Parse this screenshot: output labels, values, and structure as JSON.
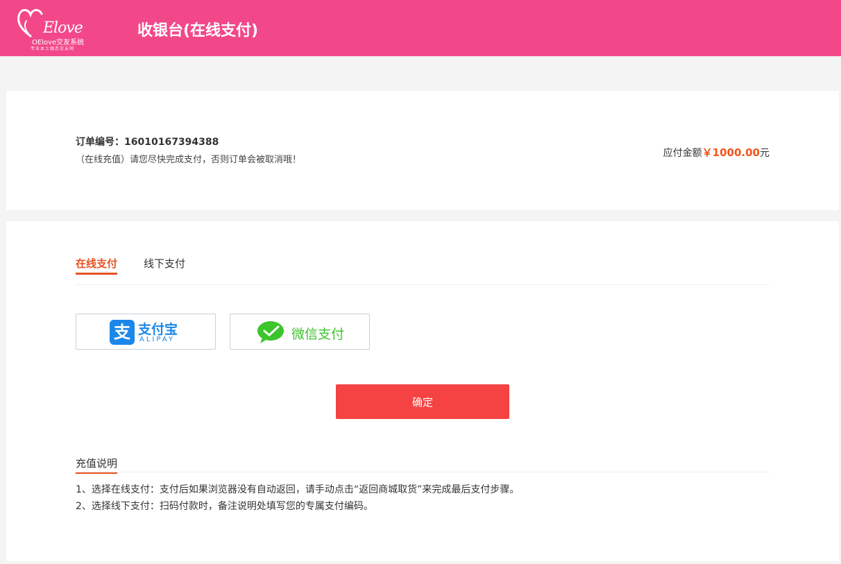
{
  "header": {
    "logo": {
      "script": "Elove",
      "name": "OElove交友系统",
      "slogan": "专业本土婚恋交友网"
    },
    "title": "收银台(在线支付)",
    "brand_color": "#f2488a"
  },
  "order": {
    "number_label": "订单编号：16010167394388",
    "hint": "（在线充值）请您尽快完成支付，否则订单会被取消哦！",
    "amount_prefix": "应付金额",
    "amount_value": "￥1000.00",
    "amount_suffix": "元",
    "amount_color": "#f2541b"
  },
  "tabs": [
    {
      "label": "在线支付",
      "active": true
    },
    {
      "label": "线下支付",
      "active": false
    }
  ],
  "payment_methods": {
    "alipay": {
      "icon": "alipay-icon",
      "glyph": "支",
      "label_cn": "支付宝",
      "label_en": "ALIPAY",
      "color": "#1b87e8"
    },
    "wechat": {
      "icon": "wechat-pay-icon",
      "label": "微信支付",
      "color": "#3bc52a"
    }
  },
  "confirm_button": {
    "label": "确定",
    "color": "#f54343"
  },
  "notes": {
    "title": "充值说明",
    "items": [
      "1、选择在线支付：支付后如果浏览器没有自动返回，请手动点击“返回商城取货”来完成最后支付步骤。",
      "2、选择线下支付：扫码付款时，备注说明处填写您的专属支付编码。"
    ]
  }
}
